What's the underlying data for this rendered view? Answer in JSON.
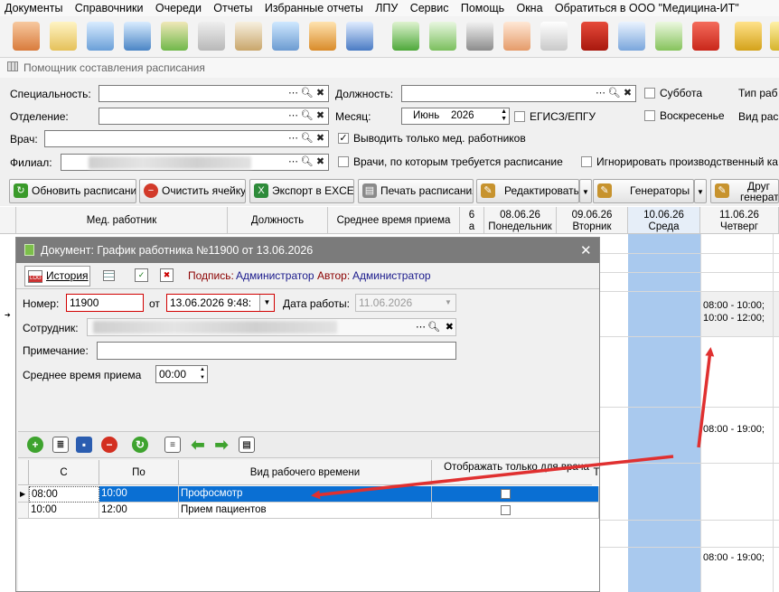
{
  "menu": [
    "Документы",
    "Справочники",
    "Очереди",
    "Отчеты",
    "Избранные отчеты",
    "ЛПУ",
    "Сервис",
    "Помощь",
    "Окна",
    "Обратиться в ООО \"Медицина-ИТ\""
  ],
  "window_title": "Помощник составления расписания",
  "filters": {
    "specialty_label": "Специальность:",
    "department_label": "Отделение:",
    "doctor_label": "Врач:",
    "branch_label": "Филиал:",
    "position_label": "Должность:",
    "month_label": "Месяц:",
    "month_value": "Июнь",
    "year_value": "2026",
    "saturday": "Суббота",
    "sunday": "Воскресенье",
    "egisz": "ЕГИСЗ/ЕПГУ",
    "only_med": "Выводить только мед. работников",
    "need_schedule": "Врачи, по которым требуется расписание",
    "ignore_cal": "Игнорировать производственный ка",
    "type_label": "Тип раб",
    "view_label": "Вид рас"
  },
  "actions": {
    "refresh": "Обновить расписание",
    "clear": "Очистить ячейку",
    "export": "Экспорт в EXCEL",
    "print": "Печать расписания",
    "edit": "Редактировать",
    "generators": "Генераторы",
    "other1": "Друг",
    "other2": "генерат"
  },
  "grid": {
    "col_worker": "Мед. работник",
    "col_position": "Должность",
    "col_avg": "Среднее время приема",
    "partial_date": "6",
    "partial_day": "а",
    "days": [
      {
        "date": "08.06.26",
        "day": "Понедельник"
      },
      {
        "date": "09.06.26",
        "day": "Вторник"
      },
      {
        "date": "10.06.26",
        "day": "Среда"
      },
      {
        "date": "11.06.26",
        "day": "Четверг"
      }
    ],
    "cell1a": "08:00 - 10:00;",
    "cell1b": "10:00 - 12:00;",
    "cell2": "08:00 - 19:00;",
    "cell3": "08:00 - 19:00;"
  },
  "dialog": {
    "title": "Документ: График работника №11900 от 13.06.2026",
    "close": "✕",
    "tab_history": "История",
    "log_badge": "LOG",
    "sign_label": "Подпись:",
    "sign_value": "Администратор",
    "author_label": "Автор:",
    "author_value": "Администратор",
    "number_label": "Номер:",
    "number_value": "11900",
    "from_label": "от",
    "from_value": "13.06.2026 9:48:",
    "workdate_label": "Дата работы:",
    "workdate_value": "11.06.2026",
    "employee_label": "Сотрудник:",
    "note_label": "Примечание:",
    "note_value": "",
    "avg_label": "Среднее время приема",
    "avg_value": "00:00",
    "table": {
      "headers": [
        "С",
        "По",
        "Вид рабочего времени",
        "Отображать только для врача",
        "Т"
      ],
      "rows": [
        {
          "from": "08:00",
          "to": "10:00",
          "kind": "Профосмотр"
        },
        {
          "from": "10:00",
          "to": "12:00",
          "kind": "Прием пациентов"
        }
      ]
    }
  },
  "colors": {
    "accent_column": "#a9c9ee",
    "selected_row": "#0078d7",
    "arrow": "#e03030"
  }
}
